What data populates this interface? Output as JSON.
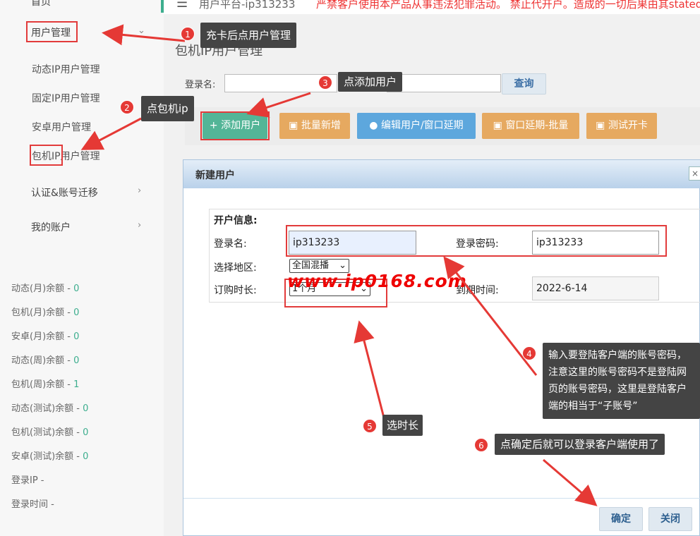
{
  "topbar": {
    "title": "用户平台-ip313233",
    "notice": "严禁客户使用本产品从事违法犯罪活动。 禁止代开户。造成的一切后果由其stated"
  },
  "sidebar": {
    "partial_top": "首页",
    "items": [
      {
        "label": "用户管理"
      },
      {
        "label": "动态IP用户管理"
      },
      {
        "label": "固定IP用户管理"
      },
      {
        "label": "安卓用户管理"
      },
      {
        "label": "包机IP用户管理"
      },
      {
        "label": "认证&账号迁移"
      },
      {
        "label": "我的账户"
      }
    ],
    "balances": [
      {
        "label": "动态(月)余额 - ",
        "value": "0"
      },
      {
        "label": "包机(月)余额 - ",
        "value": "0"
      },
      {
        "label": "安卓(月)余额 - ",
        "value": "0"
      },
      {
        "label": "动态(周)余额 - ",
        "value": "0"
      },
      {
        "label": "包机(周)余额 - ",
        "value": "1"
      },
      {
        "label": "动态(测试)余额 - ",
        "value": "0"
      },
      {
        "label": "包机(测试)余额 - ",
        "value": "0"
      },
      {
        "label": "安卓(测试)余额 - ",
        "value": "0"
      }
    ],
    "login_ip": "登录IP -",
    "login_time": "登录时间 -"
  },
  "main": {
    "page_title": "包机IP用户管理",
    "search_label": "登录名:",
    "query_button": "查询",
    "toolbar": [
      {
        "label": "+ 添加用户",
        "color": "#53b597"
      },
      {
        "label": "批量新增",
        "color": "#e6a960"
      },
      {
        "label": "编辑用户/窗口延期",
        "color": "#5da7dd"
      },
      {
        "label": "窗口延期-批量",
        "color": "#e6a960"
      },
      {
        "label": "测试开卡",
        "color": "#e6a960"
      }
    ]
  },
  "modal": {
    "title": "新建用户",
    "section": "开户信息:",
    "username_label": "登录名:",
    "username_value": "ip313233",
    "password_label": "登录密码:",
    "password_value": "ip313233",
    "region_label": "选择地区:",
    "region_value": "全国混播",
    "duration_label": "订购时长:",
    "duration_value": "1个月",
    "expire_label": "到期时间:",
    "expire_value": "2022-6-14",
    "confirm": "确定",
    "close": "关闭"
  },
  "annotations": {
    "step1": "充卡后点用户管理",
    "step2": "点包机ip",
    "step3": "点添加用户",
    "step4": "输入要登陆客户端的账号密码，注意这里的账号密码不是登陆网页的账号密码，这里是登陆客户端的相当于“子账号”",
    "step5": "选时长",
    "step6": "点确定后就可以登录客户端使用了",
    "watermark": "www.ip0168.com",
    "badges": [
      "1",
      "2",
      "3",
      "4",
      "5",
      "6"
    ]
  },
  "colors": {
    "accent": "#3dae8e",
    "annotation_red": "#e23b3b",
    "callout_bg": "#444444",
    "modal_header": "#b9d1ea"
  }
}
